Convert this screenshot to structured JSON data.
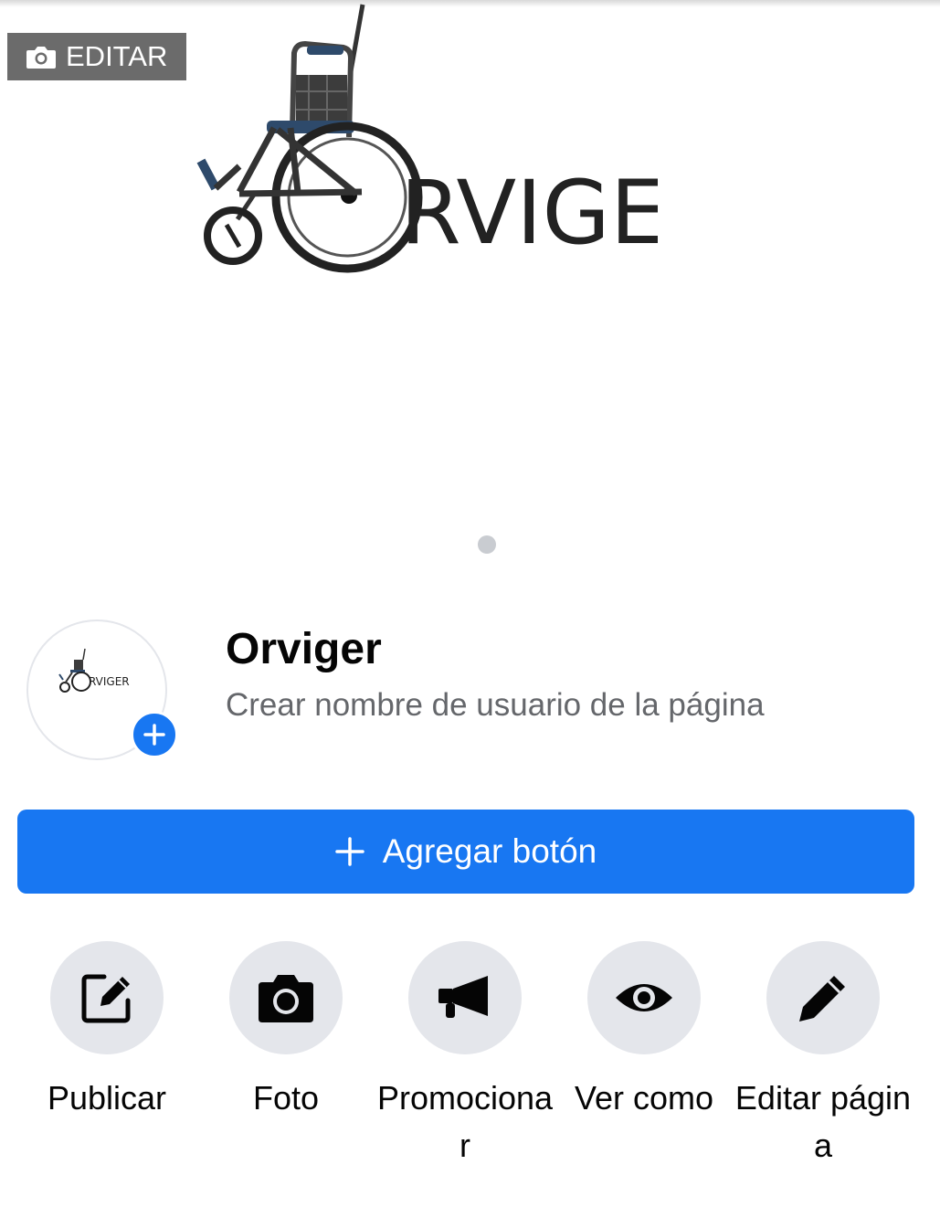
{
  "cover": {
    "edit_label": "EDITAR",
    "logo_text": "RVIGER"
  },
  "profile": {
    "name": "Orviger",
    "username_prompt": "Crear nombre de usuario de la página",
    "avatar_logo_text": "RVIGER"
  },
  "primary_action": {
    "label": "Agregar botón"
  },
  "actions": [
    {
      "label": "Publicar",
      "icon": "compose-icon"
    },
    {
      "label": "Foto",
      "icon": "camera-icon"
    },
    {
      "label": "Promocionar",
      "icon": "megaphone-icon"
    },
    {
      "label": "Ver como",
      "icon": "eye-icon"
    },
    {
      "label": "Editar página",
      "icon": "pencil-icon"
    }
  ],
  "colors": {
    "accent": "#1877f2",
    "action_circle": "#e4e6eb",
    "secondary_text": "#65676b"
  }
}
